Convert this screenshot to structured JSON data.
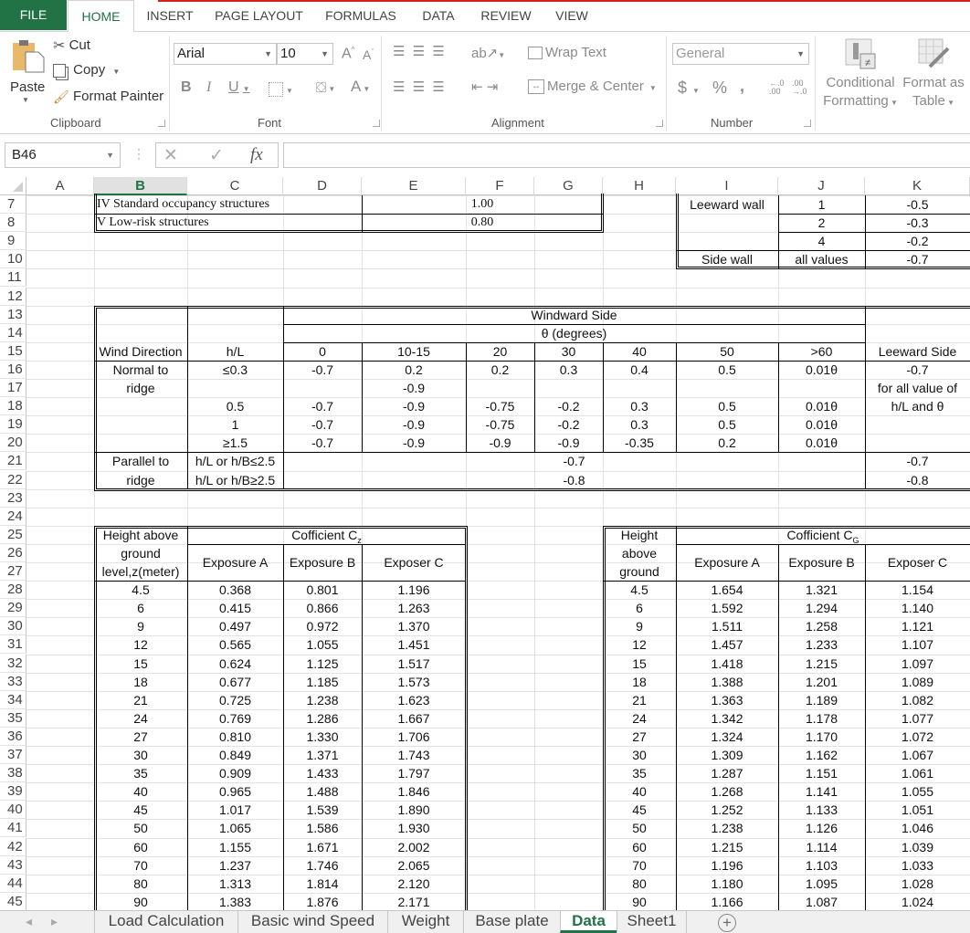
{
  "ribbon": {
    "tabs": [
      "FILE",
      "HOME",
      "INSERT",
      "PAGE LAYOUT",
      "FORMULAS",
      "DATA",
      "REVIEW",
      "VIEW"
    ],
    "active_tab": "HOME",
    "clipboard": {
      "paste": "Paste",
      "cut": "Cut",
      "copy": "Copy",
      "format_painter": "Format Painter",
      "label": "Clipboard"
    },
    "font": {
      "name": "Arial",
      "size": "10",
      "bold": "B",
      "italic": "I",
      "underline": "U",
      "grow": "A",
      "shrink": "A",
      "color": "A",
      "label": "Font"
    },
    "alignment": {
      "wrap_text": "Wrap Text",
      "merge_center": "Merge & Center",
      "label": "Alignment"
    },
    "number": {
      "format": "General",
      "currency": "$",
      "percent": "%",
      "comma": ",",
      "label": "Number"
    },
    "styles": {
      "conditional_1": "Conditional",
      "conditional_2": "Formatting",
      "format_table_1": "Format as",
      "format_table_2": "Table"
    }
  },
  "formula_bar": {
    "name_box": "B46",
    "cancel": "✕",
    "enter": "✓",
    "fx": "fx",
    "value": ""
  },
  "columns": [
    "A",
    "B",
    "C",
    "D",
    "E",
    "F",
    "G",
    "H",
    "I",
    "J",
    "K"
  ],
  "selected_column": "B",
  "rows": [
    "7",
    "8",
    "9",
    "10",
    "11",
    "12",
    "13",
    "14",
    "15",
    "16",
    "17",
    "18",
    "19",
    "20",
    "21",
    "22",
    "23",
    "24",
    "25",
    "26",
    "27",
    "28",
    "29",
    "30",
    "31",
    "32",
    "33",
    "34",
    "35",
    "36",
    "37",
    "38",
    "39",
    "40",
    "41",
    "42",
    "43",
    "44",
    "45"
  ],
  "occupancy_table": [
    {
      "category": "IV Standard occupancy structures",
      "factor": "1.00"
    },
    {
      "category": "V Low-risk structures",
      "factor": "0.80"
    }
  ],
  "wall_table": {
    "leeward_label": "Leeward wall",
    "leeward_rows": [
      {
        "ratio": "1",
        "cp": "-0.5"
      },
      {
        "ratio": "2",
        "cp": "-0.3"
      },
      {
        "ratio": "4",
        "cp": "-0.2"
      }
    ],
    "side_label": "Side wall",
    "side_ratio": "all values",
    "side_cp": "-0.7"
  },
  "roof_table": {
    "windward_header": "Windward Side",
    "theta_header": "θ (degrees)",
    "wind_direction_header": "Wind Direction",
    "hl_header": "h/L",
    "theta_values": [
      "0",
      "10-15",
      "20",
      "30",
      "40",
      "50",
      ">60"
    ],
    "leeward_header": "Leeward Side",
    "normal_label_1": "Normal to",
    "normal_label_2": "ridge",
    "normal_rows": [
      {
        "hl": "≤0.3",
        "vals": [
          "-0.7",
          "0.2",
          "0.2",
          "0.3",
          "0.4",
          "0.5",
          "0.01θ"
        ]
      },
      {
        "hl": "",
        "vals": [
          "",
          "-0.9",
          "",
          "",
          "",
          "",
          ""
        ]
      },
      {
        "hl": "0.5",
        "vals": [
          "-0.7",
          "-0.9",
          "-0.75",
          "-0.2",
          "0.3",
          "0.5",
          "0.01θ"
        ]
      },
      {
        "hl": "1",
        "vals": [
          "-0.7",
          "-0.9",
          "-0.75",
          "-0.2",
          "0.3",
          "0.5",
          "0.01θ"
        ]
      },
      {
        "hl": "≥1.5",
        "vals": [
          "-0.7",
          "-0.9",
          "-0.9",
          "-0.9",
          "-0.35",
          "0.2",
          "0.01θ"
        ]
      }
    ],
    "leeward_normal": [
      "-0.7",
      "for all value of",
      "h/L and θ"
    ],
    "parallel_label_1": "Parallel to",
    "parallel_label_2": "ridge",
    "parallel_rows": [
      {
        "hl": "h/L or h/B≤2.5",
        "windward": "-0.7",
        "leeward": "-0.7"
      },
      {
        "hl": "h/L or h/B≥2.5",
        "windward": "-0.8",
        "leeward": "-0.8"
      }
    ]
  },
  "cz_table": {
    "height_header_1": "Height above",
    "height_header_2": "ground",
    "height_header_3": "level,z(meter)",
    "coef_header": "Cofficient C",
    "coef_sub": "z",
    "exposures": [
      "Exposure A",
      "Exposure B",
      "Exposer C"
    ],
    "rows": [
      [
        "4.5",
        "0.368",
        "0.801",
        "1.196"
      ],
      [
        "6",
        "0.415",
        "0.866",
        "1.263"
      ],
      [
        "9",
        "0.497",
        "0.972",
        "1.370"
      ],
      [
        "12",
        "0.565",
        "1.055",
        "1.451"
      ],
      [
        "15",
        "0.624",
        "1.125",
        "1.517"
      ],
      [
        "18",
        "0.677",
        "1.185",
        "1.573"
      ],
      [
        "21",
        "0.725",
        "1.238",
        "1.623"
      ],
      [
        "24",
        "0.769",
        "1.286",
        "1.667"
      ],
      [
        "27",
        "0.810",
        "1.330",
        "1.706"
      ],
      [
        "30",
        "0.849",
        "1.371",
        "1.743"
      ],
      [
        "35",
        "0.909",
        "1.433",
        "1.797"
      ],
      [
        "40",
        "0.965",
        "1.488",
        "1.846"
      ],
      [
        "45",
        "1.017",
        "1.539",
        "1.890"
      ],
      [
        "50",
        "1.065",
        "1.586",
        "1.930"
      ],
      [
        "60",
        "1.155",
        "1.671",
        "2.002"
      ],
      [
        "70",
        "1.237",
        "1.746",
        "2.065"
      ],
      [
        "80",
        "1.313",
        "1.814",
        "2.120"
      ],
      [
        "90",
        "1.383",
        "1.876",
        "2.171"
      ]
    ]
  },
  "cg_table": {
    "height_header_1": "Height",
    "height_header_2": "above",
    "height_header_3": "ground",
    "coef_header": "Cofficient C",
    "coef_sub": "G",
    "exposures": [
      "Exposure A",
      "Exposure B",
      "Exposer C"
    ],
    "rows": [
      [
        "4.5",
        "1.654",
        "1.321",
        "1.154"
      ],
      [
        "6",
        "1.592",
        "1.294",
        "1.140"
      ],
      [
        "9",
        "1.511",
        "1.258",
        "1.121"
      ],
      [
        "12",
        "1.457",
        "1.233",
        "1.107"
      ],
      [
        "15",
        "1.418",
        "1.215",
        "1.097"
      ],
      [
        "18",
        "1.388",
        "1.201",
        "1.089"
      ],
      [
        "21",
        "1.363",
        "1.189",
        "1.082"
      ],
      [
        "24",
        "1.342",
        "1.178",
        "1.077"
      ],
      [
        "27",
        "1.324",
        "1.170",
        "1.072"
      ],
      [
        "30",
        "1.309",
        "1.162",
        "1.067"
      ],
      [
        "35",
        "1.287",
        "1.151",
        "1.061"
      ],
      [
        "40",
        "1.268",
        "1.141",
        "1.055"
      ],
      [
        "45",
        "1.252",
        "1.133",
        "1.051"
      ],
      [
        "50",
        "1.238",
        "1.126",
        "1.046"
      ],
      [
        "60",
        "1.215",
        "1.114",
        "1.039"
      ],
      [
        "70",
        "1.196",
        "1.103",
        "1.033"
      ],
      [
        "80",
        "1.180",
        "1.095",
        "1.028"
      ],
      [
        "90",
        "1.166",
        "1.087",
        "1.024"
      ]
    ]
  },
  "sheet_tabs": [
    "Load Calculation",
    "Basic wind Speed",
    "Weight",
    "Base plate",
    "Data",
    "Sheet1"
  ],
  "active_sheet": "Data",
  "add_sheet": "+"
}
